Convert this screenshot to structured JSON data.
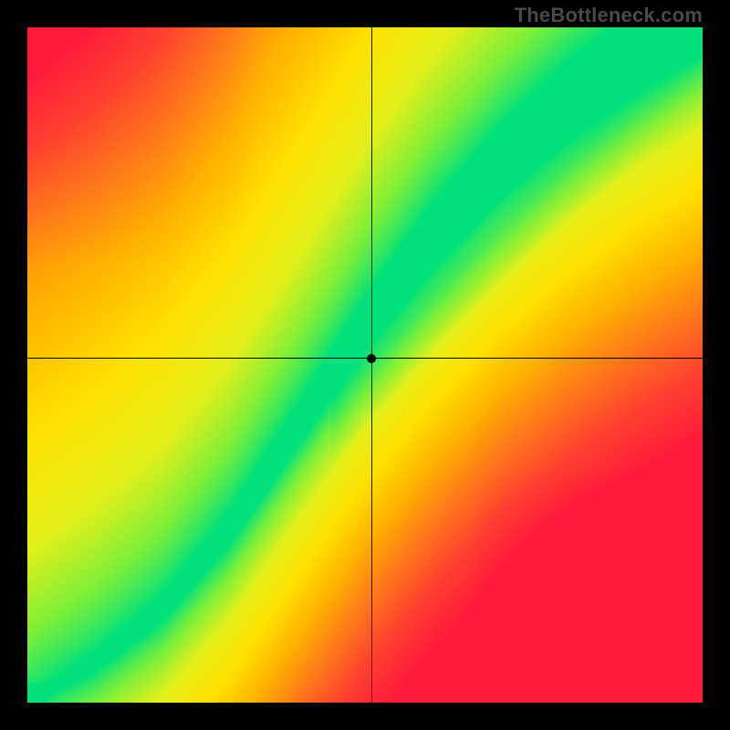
{
  "watermark": "TheBottleneck.com",
  "chart_data": {
    "type": "heatmap",
    "title": "",
    "xlabel": "",
    "ylabel": "",
    "xlim": [
      0,
      1
    ],
    "ylim": [
      0,
      1
    ],
    "marker": {
      "x": 0.51,
      "y": 0.51
    },
    "crosshair": {
      "x": 0.51,
      "y": 0.51
    },
    "optimal_band": {
      "description": "green ridge path across field; outside band fades through yellow/orange to red",
      "points": [
        {
          "x": 0.0,
          "g": 0.0,
          "half_width": 0.005
        },
        {
          "x": 0.1,
          "g": 0.06,
          "half_width": 0.015
        },
        {
          "x": 0.2,
          "g": 0.14,
          "half_width": 0.02
        },
        {
          "x": 0.3,
          "g": 0.26,
          "half_width": 0.025
        },
        {
          "x": 0.4,
          "g": 0.41,
          "half_width": 0.03
        },
        {
          "x": 0.5,
          "g": 0.56,
          "half_width": 0.04
        },
        {
          "x": 0.6,
          "g": 0.69,
          "half_width": 0.05
        },
        {
          "x": 0.7,
          "g": 0.8,
          "half_width": 0.055
        },
        {
          "x": 0.8,
          "g": 0.89,
          "half_width": 0.06
        },
        {
          "x": 0.9,
          "g": 0.96,
          "half_width": 0.06
        },
        {
          "x": 1.0,
          "g": 1.02,
          "half_width": 0.06
        }
      ]
    },
    "secondary_ridge": {
      "description": "faint yellow-green diagonal y≈x below main band for x>0.5",
      "slope": 1.0,
      "intercept": 0.0
    },
    "colormap": {
      "stops": [
        {
          "t": 0.0,
          "hex": "#00e17b"
        },
        {
          "t": 0.12,
          "hex": "#7bef3a"
        },
        {
          "t": 0.25,
          "hex": "#e3ef1a"
        },
        {
          "t": 0.4,
          "hex": "#ffe100"
        },
        {
          "t": 0.55,
          "hex": "#ffb400"
        },
        {
          "t": 0.7,
          "hex": "#ff7a1a"
        },
        {
          "t": 0.85,
          "hex": "#ff4030"
        },
        {
          "t": 1.0,
          "hex": "#ff1a3b"
        }
      ]
    },
    "grid_resolution": 160
  }
}
